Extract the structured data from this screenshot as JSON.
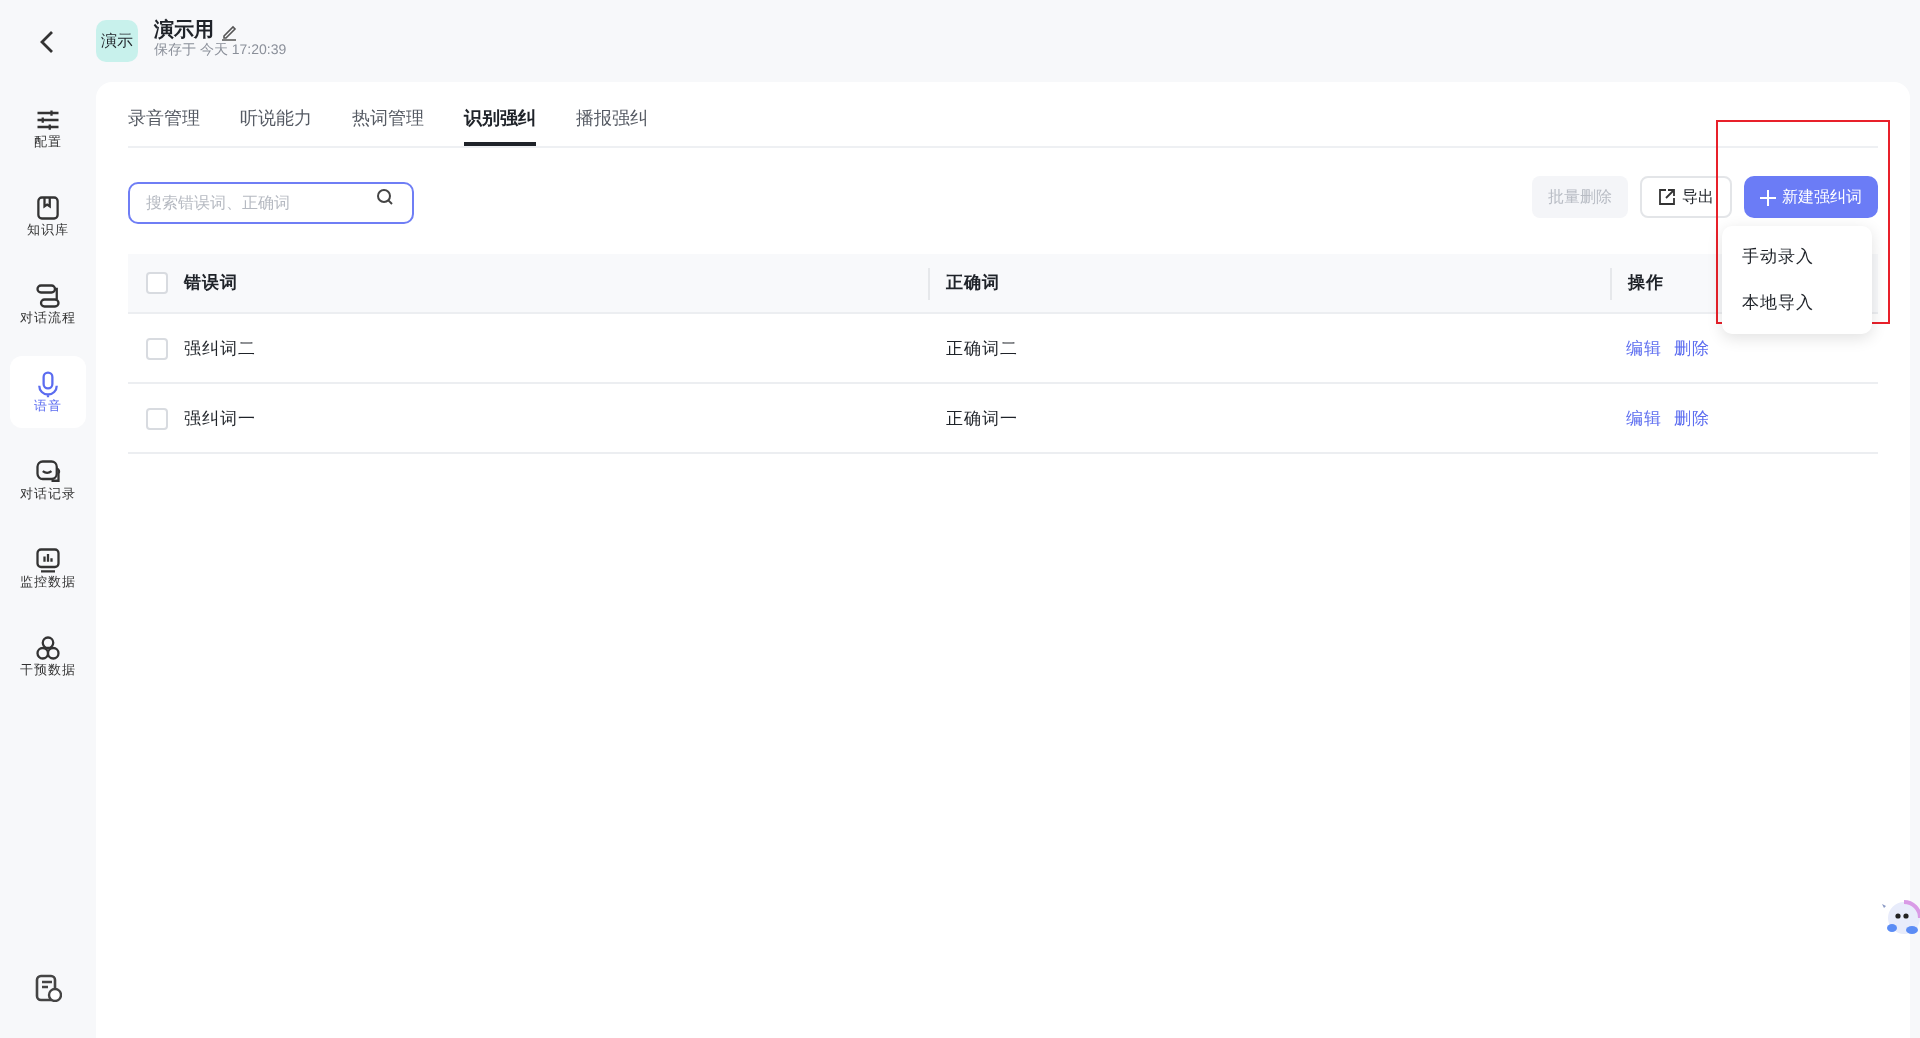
{
  "header": {
    "badge": "演示",
    "title": "演示用",
    "saved": "保存于 今天 17:20:39"
  },
  "sidebar": {
    "items": [
      {
        "label": "配置",
        "selected": false
      },
      {
        "label": "知识库",
        "selected": false
      },
      {
        "label": "对话流程",
        "selected": false
      },
      {
        "label": "语音",
        "selected": true
      },
      {
        "label": "对话记录",
        "selected": false
      },
      {
        "label": "监控数据",
        "selected": false
      },
      {
        "label": "干预数据",
        "selected": false
      }
    ]
  },
  "tabs": [
    {
      "label": "录音管理",
      "selected": false
    },
    {
      "label": "听说能力",
      "selected": false
    },
    {
      "label": "热词管理",
      "selected": false
    },
    {
      "label": "识别强纠",
      "selected": true
    },
    {
      "label": "播报强纠",
      "selected": false
    }
  ],
  "search": {
    "placeholder": "搜索错误词、正确词"
  },
  "toolbar": {
    "batch_delete": {
      "label": "批量删除",
      "disabled": true
    },
    "export": "导出",
    "create": "新建强纠词"
  },
  "dropdown": {
    "items": [
      "手动录入",
      "本地导入"
    ]
  },
  "table": {
    "all_checked": false,
    "columns": [
      "错误词",
      "正确词",
      "操作"
    ],
    "rows": [
      {
        "checked": false,
        "wrong": "强纠词二",
        "correct": "正确词二",
        "actions": [
          "编辑",
          "删除"
        ]
      },
      {
        "checked": false,
        "wrong": "强纠词一",
        "correct": "正确词一",
        "actions": [
          "编辑",
          "删除"
        ]
      }
    ]
  }
}
